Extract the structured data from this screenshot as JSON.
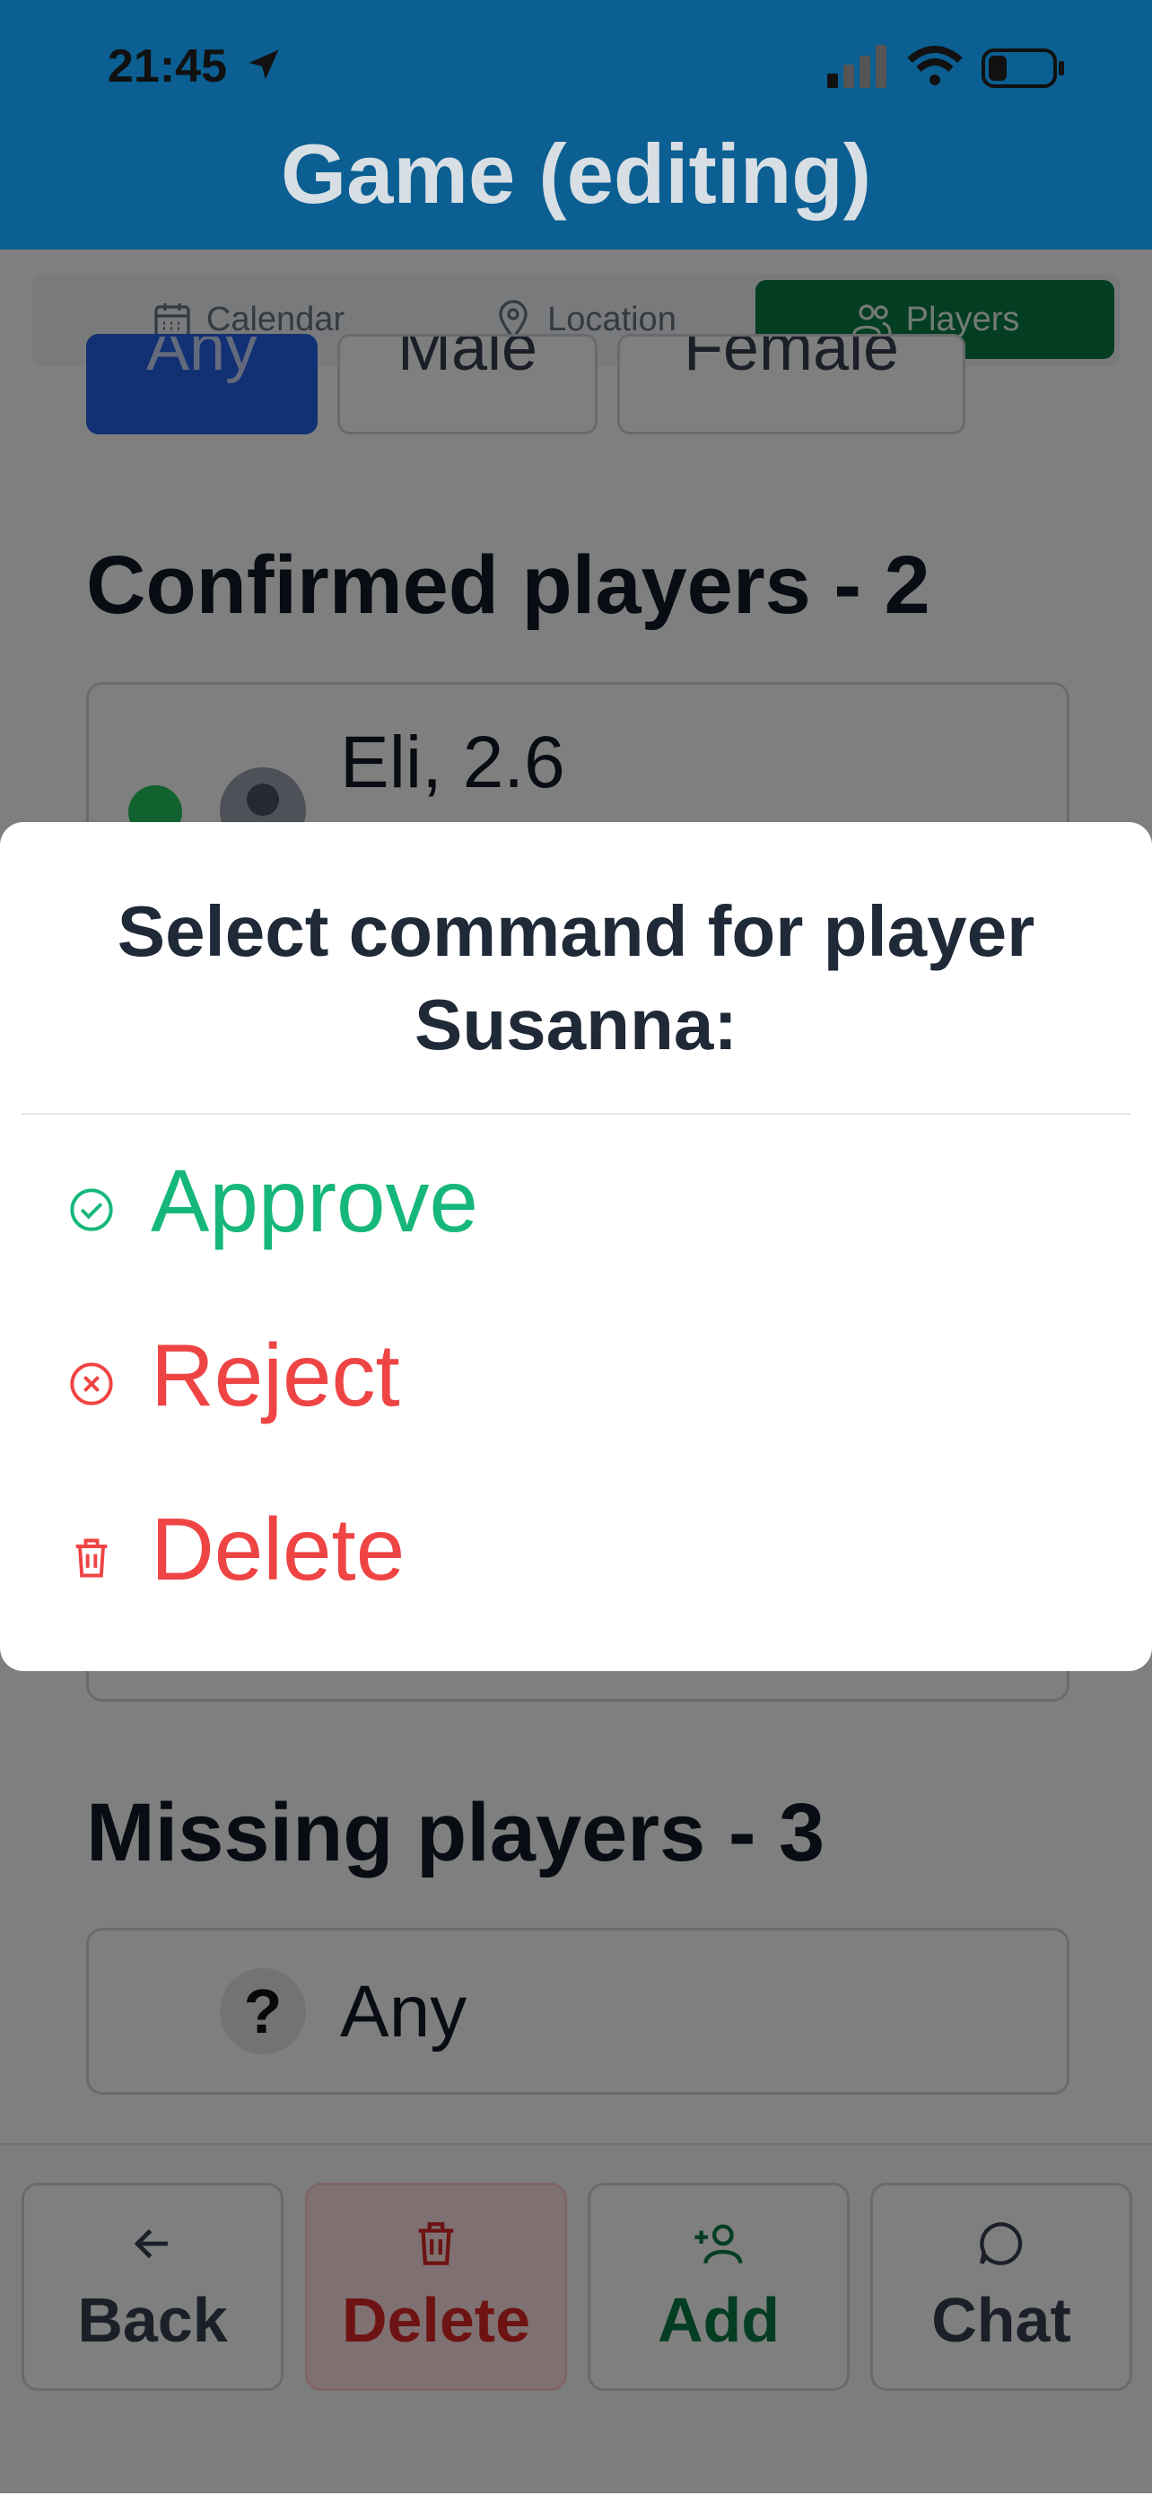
{
  "status_bar": {
    "time": "21:45"
  },
  "header": {
    "title": "Game (editing)"
  },
  "tabs": [
    {
      "label": "Calendar",
      "icon": "calendar-icon"
    },
    {
      "label": "Location",
      "icon": "map-pin-icon"
    },
    {
      "label": "Players",
      "icon": "users-icon",
      "active": true
    }
  ],
  "filters": [
    "Any",
    "Male",
    "Female"
  ],
  "confirmed": {
    "title": "Confirmed players - 2",
    "players": [
      {
        "name": "Eli, 2.6"
      }
    ]
  },
  "missing": {
    "title": "Missing players - 3",
    "slots": [
      {
        "label": "Any"
      }
    ]
  },
  "bottom_bar": {
    "back": "Back",
    "delete": "Delete",
    "add": "Add",
    "chat": "Chat"
  },
  "dialog": {
    "title": "Select command for player Susanna:",
    "commands": [
      {
        "label": "Approve",
        "icon": "check-circle-icon",
        "color": "#16b77a"
      },
      {
        "label": "Reject",
        "icon": "x-circle-icon",
        "color": "#ef4444"
      },
      {
        "label": "Delete",
        "icon": "trash-icon",
        "color": "#ef4444"
      }
    ]
  },
  "colors": {
    "header_bg": "#0b5f92",
    "accent_green": "#067a45",
    "accent_blue": "#2563eb",
    "danger": "#ef4444"
  }
}
